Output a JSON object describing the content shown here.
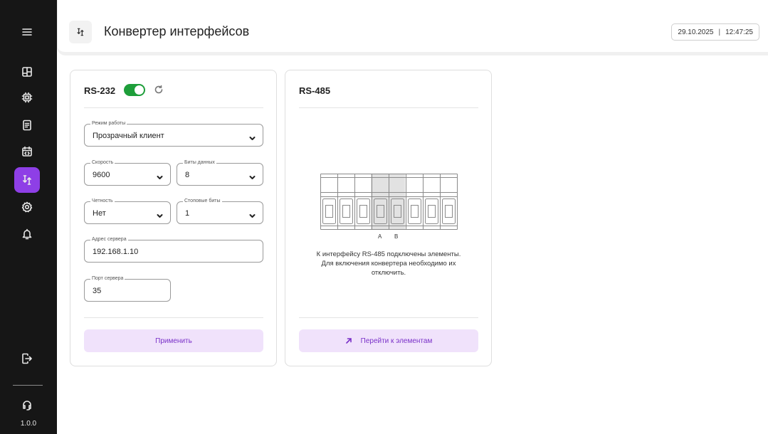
{
  "sidebar": {
    "items": [
      {
        "name": "menu-icon"
      },
      {
        "name": "dashboard-icon"
      },
      {
        "name": "chip-icon"
      },
      {
        "name": "document-icon"
      },
      {
        "name": "calendar-code-icon"
      },
      {
        "name": "converter-icon",
        "active": true
      },
      {
        "name": "settings-icon"
      },
      {
        "name": "bell-icon"
      },
      {
        "name": "logout-icon"
      },
      {
        "name": "support-icon"
      }
    ],
    "version": "1.0.0"
  },
  "header": {
    "icon": "converter-icon",
    "title": "Конвертер интерфейсов",
    "date": "29.10.2025",
    "separator": "|",
    "time": "12:47:25"
  },
  "rs232": {
    "title": "RS-232",
    "enabled": true,
    "mode": {
      "label": "Режим работы",
      "value": "Прозрачный клиент"
    },
    "speed": {
      "label": "Скорость",
      "value": "9600"
    },
    "data_bits": {
      "label": "Биты данных",
      "value": "8"
    },
    "parity": {
      "label": "Четность",
      "value": "Нет"
    },
    "stop_bits": {
      "label": "Стоповые биты",
      "value": "1"
    },
    "server_address": {
      "label": "Адрес сервера",
      "value": "192.168.1.10"
    },
    "server_port": {
      "label": "Порт сервера",
      "value": "35"
    },
    "apply_label": "Применить"
  },
  "rs485": {
    "title": "RS-485",
    "label_a": "A",
    "label_b": "B",
    "info_line1": "К интерфейсу RS-485 подключены элементы.",
    "info_line2": "Для включения конвертера необходимо их",
    "info_line3": "отключить.",
    "goto_label": "Перейти к элементам"
  },
  "colors": {
    "sidebar_bg": "#161616",
    "accent": "#8e3fe6",
    "toggle_on": "#1e9e3a",
    "button_bg": "#f0e2fb",
    "button_text": "#7a31c8"
  }
}
